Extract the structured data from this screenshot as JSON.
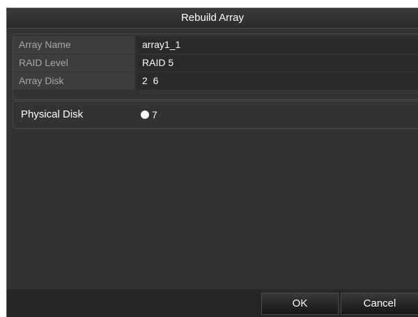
{
  "dialog": {
    "title": "Rebuild Array"
  },
  "array_info": [
    {
      "label": "Array Name",
      "value": "array1_1"
    },
    {
      "label": "RAID Level",
      "value": "RAID 5"
    },
    {
      "label": "Array Disk",
      "value": "2  6"
    }
  ],
  "physical_disk": {
    "label": "Physical Disk",
    "options": [
      {
        "value": "7",
        "selected": true
      }
    ]
  },
  "buttons": {
    "ok": "OK",
    "cancel": "Cancel"
  },
  "colors": {
    "dialog_bg": "#333333",
    "label_bg": "#3d3d3d",
    "value_bg": "#2a2a2a",
    "footer_bg": "#262626",
    "label_text": "#a8a8a8",
    "text": "#ffffff"
  }
}
